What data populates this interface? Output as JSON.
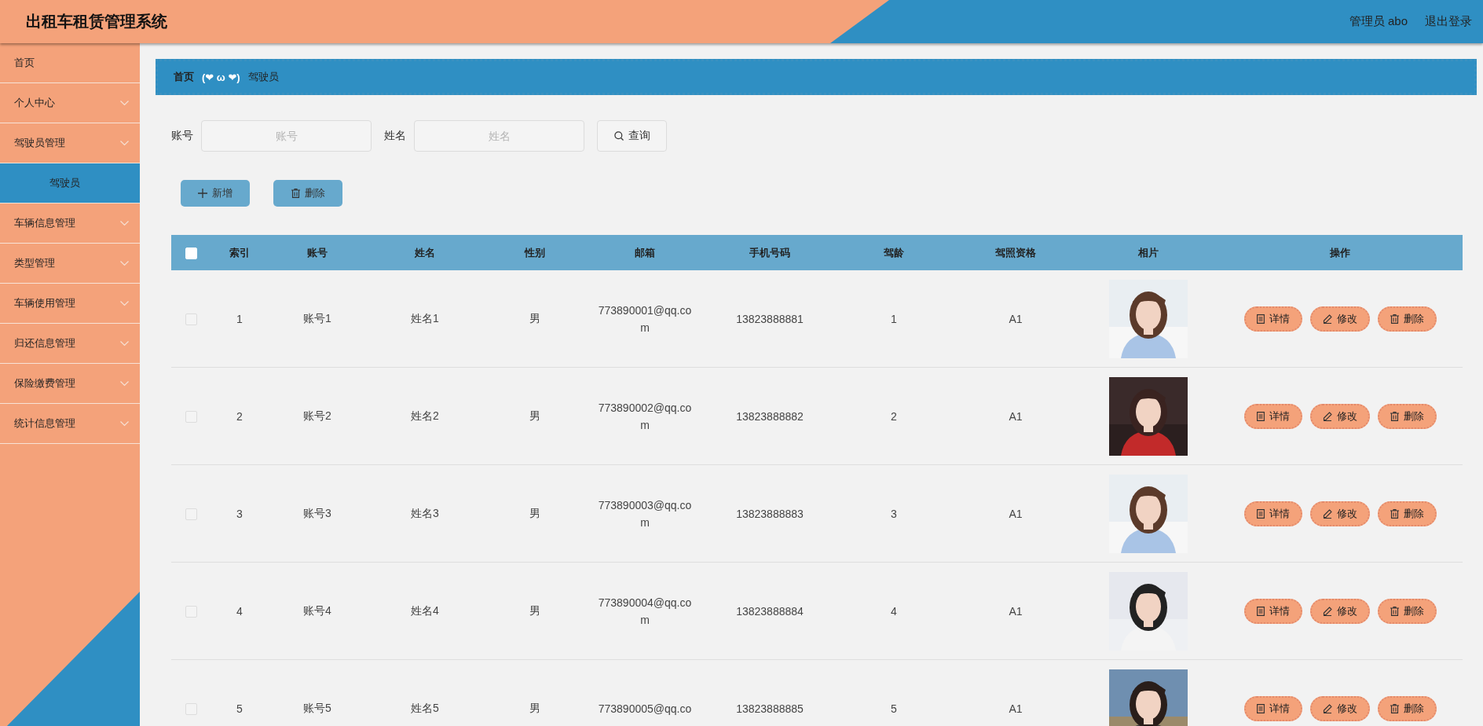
{
  "header": {
    "title": "出租车租赁管理系统",
    "user": "管理员 abo",
    "logout": "退出登录"
  },
  "sidebar": {
    "items": [
      {
        "label": "首页",
        "selected": false
      },
      {
        "label": "个人中心",
        "selected": false
      },
      {
        "label": "驾驶员管理",
        "selected": false,
        "children": [
          {
            "label": "驾驶员",
            "selected": true
          }
        ]
      },
      {
        "label": "车辆信息管理",
        "selected": false
      },
      {
        "label": "类型管理",
        "selected": false
      },
      {
        "label": "车辆使用管理",
        "selected": false
      },
      {
        "label": "归还信息管理",
        "selected": false
      },
      {
        "label": "保险缴费管理",
        "selected": false
      },
      {
        "label": "统计信息管理",
        "selected": false
      }
    ]
  },
  "breadcrumb": {
    "home": "首页",
    "separator": "(❤ ω ❤)",
    "current": "驾驶员"
  },
  "search": {
    "fields": [
      {
        "label": "账号",
        "placeholder": "账号"
      },
      {
        "label": "姓名",
        "placeholder": "姓名"
      }
    ],
    "button": "查询"
  },
  "actions": [
    {
      "kind": "add",
      "label": "新增"
    },
    {
      "kind": "delete",
      "label": "删除"
    }
  ],
  "table": {
    "header_checked": false,
    "columns": [
      "索引",
      "账号",
      "姓名",
      "性别",
      "邮箱",
      "手机号码",
      "驾龄",
      "驾照资格",
      "相片",
      "操作"
    ],
    "rows": [
      {
        "checked": false,
        "cells": [
          "1",
          "账号1",
          "姓名1",
          "男",
          "773890001@qq.com",
          "13823888881",
          "1",
          "A1"
        ],
        "actions": [
          {
            "kind": "detail",
            "label": "详情"
          },
          {
            "kind": "edit",
            "label": "修改"
          },
          {
            "kind": "delete",
            "label": "删除"
          }
        ]
      },
      {
        "checked": false,
        "cells": [
          "2",
          "账号2",
          "姓名2",
          "男",
          "773890002@qq.com",
          "13823888882",
          "2",
          "A1"
        ],
        "actions": [
          {
            "kind": "detail",
            "label": "详情"
          },
          {
            "kind": "edit",
            "label": "修改"
          },
          {
            "kind": "delete",
            "label": "删除"
          }
        ]
      },
      {
        "checked": false,
        "cells": [
          "3",
          "账号3",
          "姓名3",
          "男",
          "773890003@qq.com",
          "13823888883",
          "3",
          "A1"
        ],
        "actions": [
          {
            "kind": "detail",
            "label": "详情"
          },
          {
            "kind": "edit",
            "label": "修改"
          },
          {
            "kind": "delete",
            "label": "删除"
          }
        ]
      },
      {
        "checked": false,
        "cells": [
          "4",
          "账号4",
          "姓名4",
          "男",
          "773890004@qq.com",
          "13823888884",
          "4",
          "A1"
        ],
        "actions": [
          {
            "kind": "detail",
            "label": "详情"
          },
          {
            "kind": "edit",
            "label": "修改"
          },
          {
            "kind": "delete",
            "label": "删除"
          }
        ]
      },
      {
        "checked": false,
        "cells": [
          "5",
          "账号5",
          "姓名5",
          "男",
          "773890005@qq.co",
          "13823888885",
          "5",
          "A1"
        ],
        "actions": [
          {
            "kind": "detail",
            "label": "详情"
          },
          {
            "kind": "edit",
            "label": "修改"
          },
          {
            "kind": "delete",
            "label": "删除"
          }
        ]
      }
    ]
  }
}
